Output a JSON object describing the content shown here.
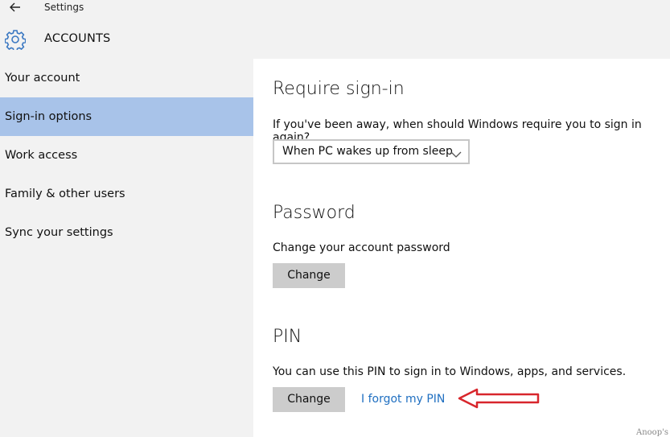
{
  "window": {
    "title": "Settings"
  },
  "header": {
    "title": "ACCOUNTS"
  },
  "sidebar": {
    "items": [
      {
        "label": "Your account"
      },
      {
        "label": "Sign-in options",
        "selected": true
      },
      {
        "label": "Work access"
      },
      {
        "label": "Family & other users"
      },
      {
        "label": "Sync your settings"
      }
    ]
  },
  "main": {
    "require_signin": {
      "title": "Require sign-in",
      "description": "If you've been away, when should Windows require you to sign in again?",
      "dropdown_value": "When PC wakes up from sleep"
    },
    "password": {
      "title": "Password",
      "description": "Change your account password",
      "change_button": "Change"
    },
    "pin": {
      "title": "PIN",
      "description": "You can use this PIN to sign in to Windows, apps, and services.",
      "change_button": "Change",
      "forgot_link": "I forgot my PIN"
    }
  },
  "watermark": "Anoop's",
  "colors": {
    "selected_nav": "#a8c3e9",
    "link": "#1f6fc1",
    "annotation_arrow": "#d8262c",
    "button": "#cccccc"
  },
  "icons": [
    "back-arrow-icon",
    "gear-icon",
    "chevron-down-icon"
  ]
}
